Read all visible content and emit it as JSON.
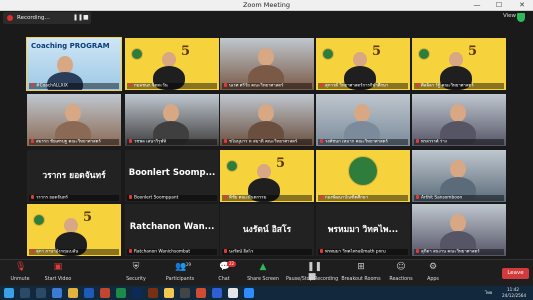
{
  "window": {
    "title": "Zoom Meeting"
  },
  "recording": {
    "label": "Recording..."
  },
  "view": {
    "label": "View"
  },
  "tiles": [
    {
      "name": "#CoachALLXIX",
      "big": "",
      "caption": "Coaching PROGRAM"
    },
    {
      "name": "กมลชนก จิตตะวัน",
      "big": ""
    },
    {
      "name": "นเรศ ศรีวัย คณะวิทยาศาสตร์",
      "big": ""
    },
    {
      "name": "สุภาวดี วิทยาศาสตร์การกีฬาศึกษา",
      "big": ""
    },
    {
      "name": "ศิลลิลา ร์ฐี คณะวิทยาศาสตร์",
      "big": ""
    },
    {
      "name": "สมรรถ ชัยเศรษฐ คณะวิทยาศาสตร์",
      "big": ""
    },
    {
      "name": "วชพล เสนาวิรุฬห์",
      "big": ""
    },
    {
      "name": "ชไมนุมาร ห สมาดิ คณะวิทยาศาสตร์",
      "big": ""
    },
    {
      "name": "วงศ์ชนก เหมาก คณะวิทยาศาสตร์",
      "big": ""
    },
    {
      "name": "พรสวรรค์ ร่าง",
      "big": ""
    },
    {
      "name": "วรากร ยอดจันทร์",
      "big": "วรากร ยอดจันทร์"
    },
    {
      "name": "Boonlert Soomppant",
      "big": "Boonlert  Soomp..."
    },
    {
      "name": "พิชัย คณะทันตกรรม",
      "big": ""
    },
    {
      "name": "กองพัฒนาบัณฑิตศึกษา",
      "big": ""
    },
    {
      "name": "Arthit Sansomboon",
      "big": ""
    },
    {
      "name": "สุภา ภาษาอังกฤษเบลัน",
      "big": ""
    },
    {
      "name": "Ratchanon Wanichsombat",
      "big": "Ratchanon  Wan..."
    },
    {
      "name": "นงรัตน์ อิสโร",
      "big": "นงรัตน์ อิสโร"
    },
    {
      "name": "พรหมมา วิทคไพรอมี่math pnru",
      "big": "พรหมมา วิทคไพ..."
    },
    {
      "name": "สุภิดา สนงาน คณะวิทยาศาสตร์",
      "big": ""
    }
  ],
  "toolbar": {
    "unmute": "Unmute",
    "start_video": "Start Video",
    "security": "Security",
    "participants": "Participants",
    "participants_count": "29",
    "chat": "Chat",
    "chat_badge": "22",
    "share": "Share Screen",
    "pause": "Pause/Stop Recording",
    "breakout": "Breakout Rooms",
    "reactions": "Reactions",
    "apps": "Apps",
    "leave": "Leave"
  },
  "taskbar": {
    "lang": "ไทย",
    "time": "11:42",
    "date": "24/12/2564"
  },
  "colors": {
    "accent": "#f6d23c",
    "leave": "#d23b3b",
    "share": "#2dba5a"
  }
}
